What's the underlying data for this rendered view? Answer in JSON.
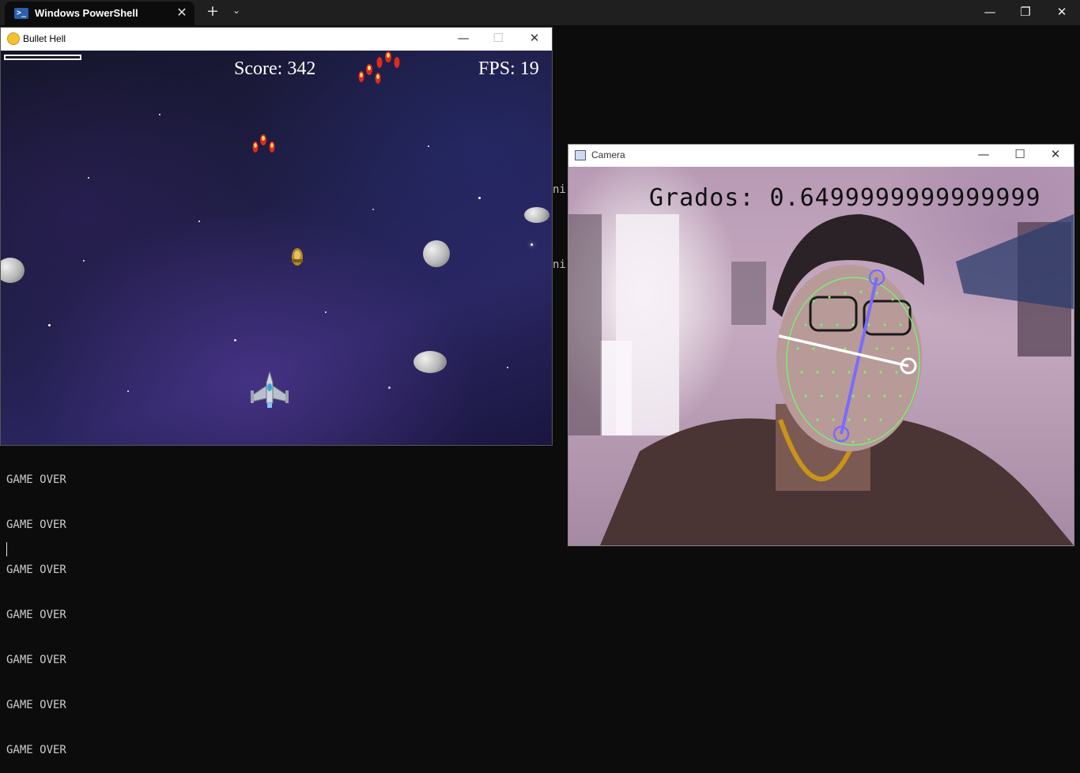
{
  "terminal": {
    "tab_title": "Windows PowerShell",
    "tab_icon": "powershell-icon",
    "output_lines": [
      "GAME OVER",
      "GAME OVER",
      "GAME OVER",
      "GAME OVER",
      "GAME OVER",
      "GAME OVER",
      "GAME OVER"
    ],
    "fragment_1": "ni",
    "fragment_2": "ni",
    "colors": {
      "background": "#0c0c0c",
      "text": "#cccccc",
      "titlebar": "#1f1f1f"
    }
  },
  "game_window": {
    "title": "Bullet Hell",
    "icon": "python-icon",
    "score_label": "Score: 342",
    "fps_label": "FPS: 19",
    "health_fraction": 0.0
  },
  "camera_window": {
    "title": "Camera",
    "icon": "camera-window-icon",
    "overlay_text": "Grados: 0.6499999999999999",
    "colors": {
      "mesh": "#6dff6d",
      "axis": "#7a6bff",
      "line": "#ffffff"
    }
  }
}
